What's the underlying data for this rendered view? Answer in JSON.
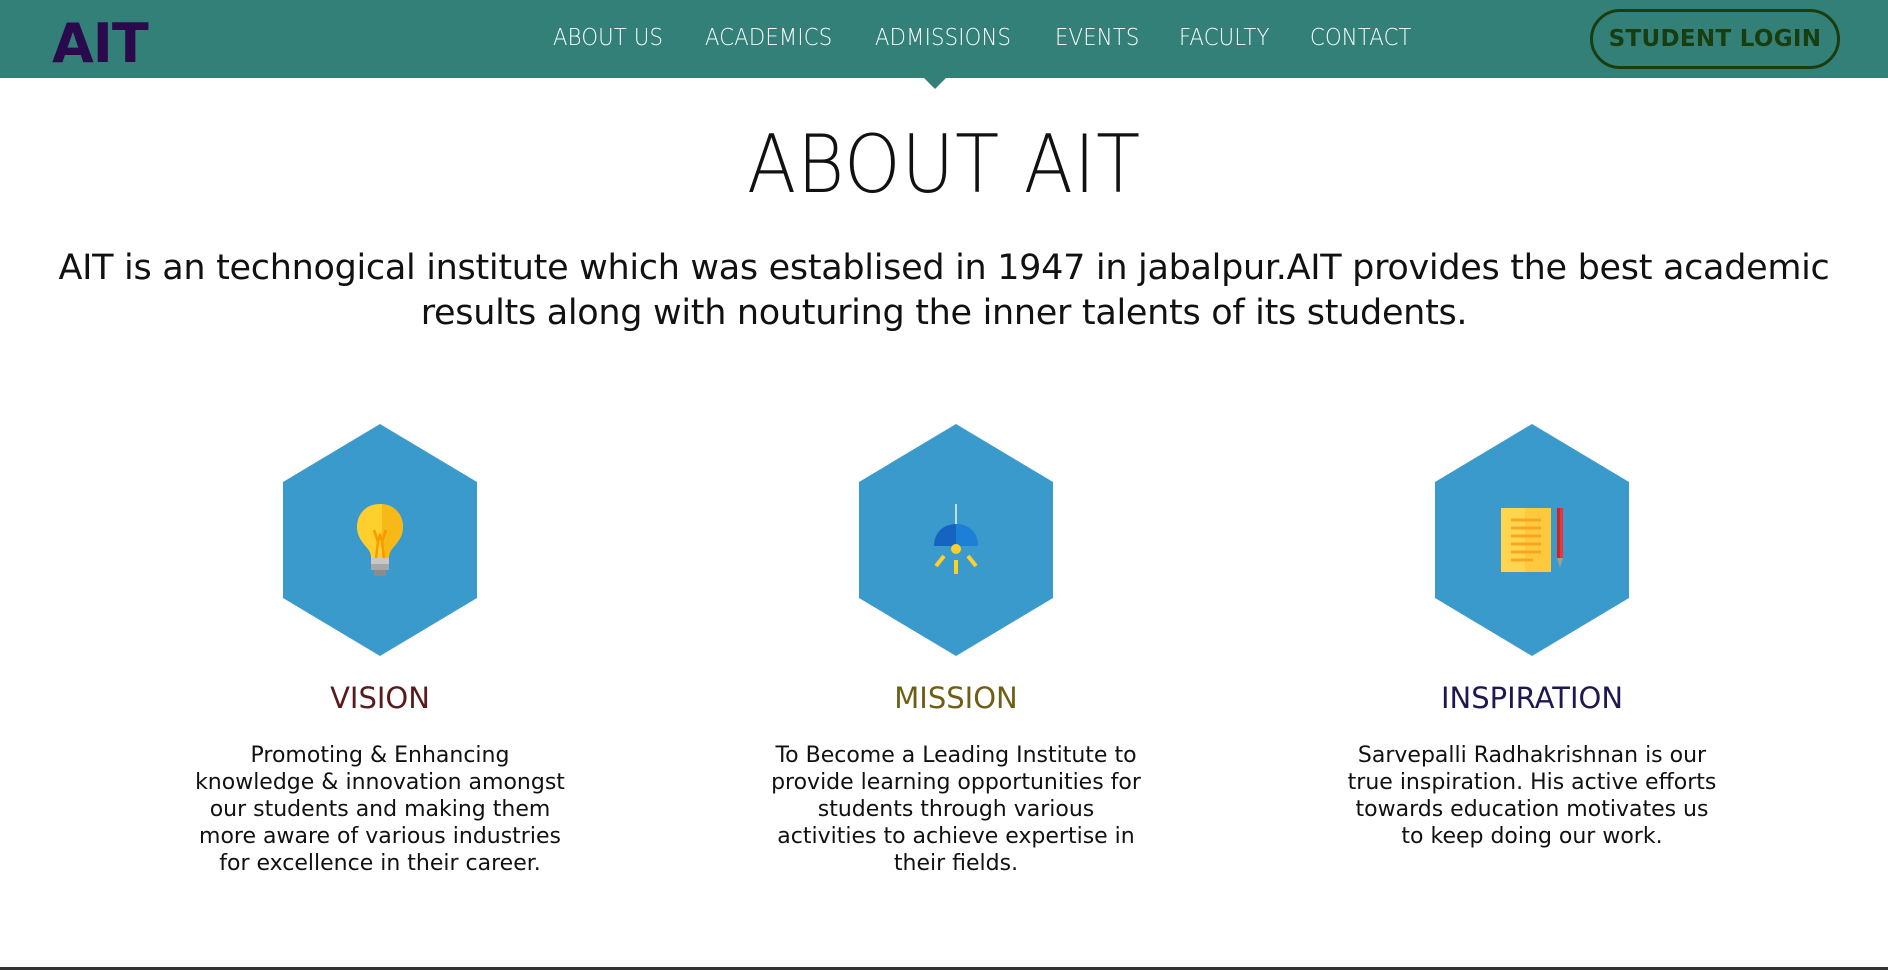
{
  "brand": {
    "logo": "AIT",
    "colors": {
      "navbar": "#338079",
      "logo": "#2a0a4d",
      "login_border": "#1a3d10",
      "hexagon": "#3a9acc",
      "vision_title": "#5a1a1a",
      "mission_title": "#6e5f14",
      "inspiration_title": "#1f1850"
    }
  },
  "nav": {
    "items": [
      {
        "label": "ABOUT US"
      },
      {
        "label": "ACADEMICS"
      },
      {
        "label": "ADMISSIONS",
        "active": true
      },
      {
        "label": "EVENTS"
      },
      {
        "label": "FACULTY"
      },
      {
        "label": "CONTACT"
      }
    ],
    "login_label": "STUDENT LOGIN"
  },
  "main": {
    "title": "ABOUT AIT",
    "intro": "AIT is an technogical institute which was establised in 1947 in jabalpur.AIT provides the best academic results along with nouturing the inner talents of its students."
  },
  "cards": [
    {
      "icon": "lightbulb-icon",
      "title": "VISION",
      "text": "Promoting & Enhancing knowledge & innovation amongst our students and making them more aware of various industries for excellence in their career."
    },
    {
      "icon": "lamp-icon",
      "title": "MISSION",
      "text": "To Become a Leading Institute to provide learning opportunities for students through various activities to achieve expertise in their fields."
    },
    {
      "icon": "notebook-pen-icon",
      "title": "INSPIRATION",
      "text": "Sarvepalli Radhakrishnan is our true inspiration. His active efforts towards education motivates us to keep doing our work."
    }
  ]
}
